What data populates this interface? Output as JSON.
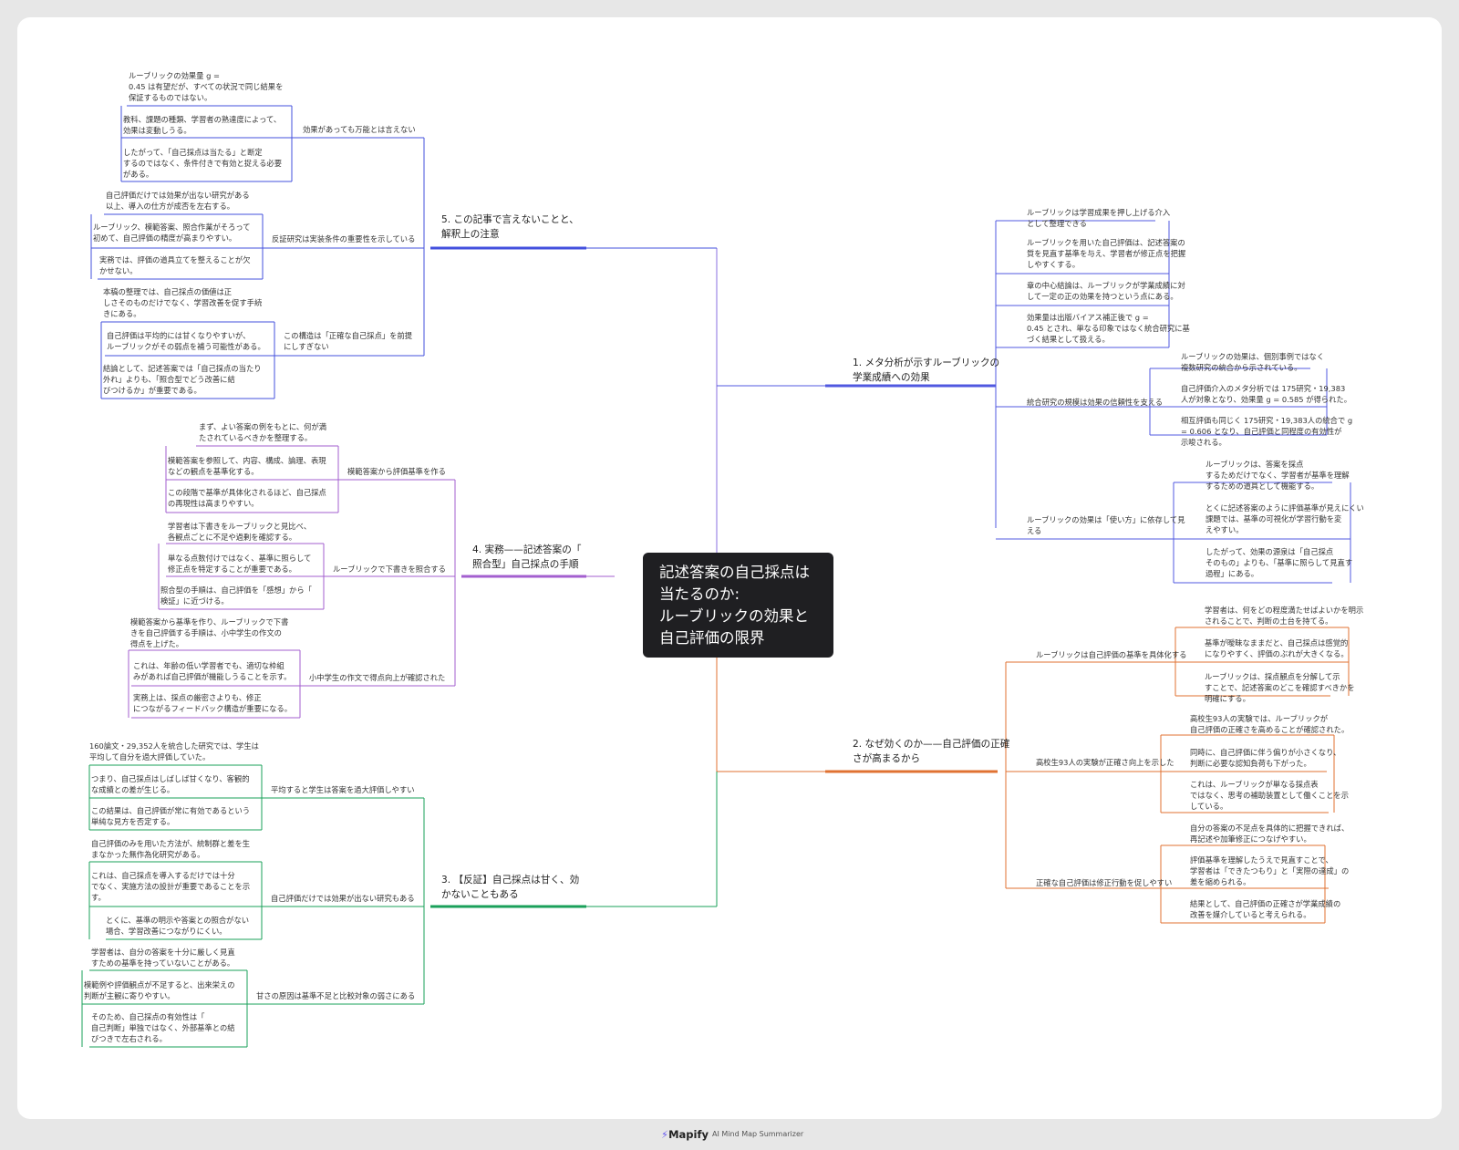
{
  "root": {
    "title": "記述答案の自己採点は\n当たるのか:\nルーブリックの効果と\n自己評価の限界"
  },
  "colors": {
    "b1": "#5058e0",
    "b2": "#e07232",
    "b3": "#1aa05a",
    "b4": "#a35fcf",
    "b5": "#4350de",
    "connector": "#8a6fe0"
  },
  "branches": [
    {
      "title": "1. メタ分析が示すルーブリックの\n学業成績への効果",
      "leaves": [
        "ルーブリックは学習成果を押し上げる介入\nとして整理できる",
        "ルーブリックを用いた自己評価は、記述答案の\n質を見直す基準を与え、学習者が修正点を把握\nしやすくする。",
        "章の中心結論は、ルーブリックが学業成績に対\nして一定の正の効果を持つという点にある。",
        "効果量は出版バイアス補正後で g =\n0.45 とされ、単なる印象ではなく統合研究に基\nづく結果として扱える。"
      ],
      "subs": [
        {
          "label": "統合研究の規模は効果の信頼性を支える",
          "leaves": [
            "ルーブリックの効果は、個別事例ではなく\n複数研究の統合から示されている。",
            "自己評価介入のメタ分析では 175研究・19,383\n人が対象となり、効果量 g = 0.585 が得られた。",
            "相互評価も同じく 175研究・19,383人の統合で g\n= 0.606 となり、自己評価と同程度の有効性が\n示唆される。"
          ]
        },
        {
          "label": "ルーブリックの効果は「使い方」に依存して見\nえる",
          "leaves": [
            "ルーブリックは、答案を採点\nするためだけでなく、学習者が基準を理解\nするための道具として機能する。",
            "とくに記述答案のように評価基準が見えにくい\n課題では、基準の可視化が学習行動を変\nえやすい。",
            "したがって、効果の源泉は「自己採点\nそのもの」よりも、「基準に照らして見直す\n過程」にある。"
          ]
        }
      ]
    },
    {
      "title": "2. なぜ効くのか——自己評価の正確\nさが高まるから",
      "subs": [
        {
          "label": "ルーブリックは自己評価の基準を具体化する",
          "leaves": [
            "学習者は、何をどの程度満たせばよいかを明示\nされることで、判断の土台を持てる。",
            "基準が曖昧なままだと、自己採点は感覚的\nになりやすく、評価のぶれが大きくなる。",
            "ルーブリックは、採点観点を分解して示\nすことで、記述答案のどこを確認すべきかを\n明確にする。"
          ]
        },
        {
          "label": "高校生93人の実験が正確さ向上を示した",
          "leaves": [
            "高校生93人の実験では、ルーブリックが\n自己評価の正確さを高めることが確認された。",
            "同時に、自己評価に伴う偏りが小さくなり、\n判断に必要な認知負荷も下がった。",
            "これは、ルーブリックが単なる採点表\nではなく、思考の補助装置として働くことを示\nしている。"
          ]
        },
        {
          "label": "正確な自己評価は修正行動を促しやすい",
          "leaves": [
            "自分の答案の不足点を具体的に把握できれば、\n再記述や加筆修正につなげやすい。",
            "評価基準を理解したうえで見直すことで、\n学習者は「できたつもり」と「実際の達成」の\n差を縮められる。",
            "結果として、自己評価の正確さが学業成績の\n改善を媒介していると考えられる。"
          ]
        }
      ]
    },
    {
      "title": "3. 【反証】自己採点は甘く、効\nかないこともある",
      "subs": [
        {
          "label": "平均すると学生は答案を過大評価しやすい",
          "leaves": [
            "160論文・29,352人を統合した研究では、学生は\n平均して自分を過大評価していた。",
            "つまり、自己採点はしばしば甘くなり、客観的\nな成績との差が生じる。",
            "この結果は、自己評価が常に有効であるという\n単純な見方を否定する。"
          ]
        },
        {
          "label": "自己評価だけでは効果が出ない研究もある",
          "leaves": [
            "自己評価のみを用いた方法が、統制群と差を生\nまなかった無作為化研究がある。",
            "これは、自己採点を導入するだけでは十分\nでなく、実施方法の設計が重要であることを示\nす。",
            "とくに、基準の明示や答案との照合がない\n場合、学習改善につながりにくい。"
          ]
        },
        {
          "label": "甘さの原因は基準不足と比較対象の弱さにある",
          "leaves": [
            "学習者は、自分の答案を十分に厳しく見直\nすための基準を持っていないことがある。",
            "模範例や評価観点が不足すると、出来栄えの\n判断が主観に寄りやすい。",
            "そのため、自己採点の有効性は「\n自己判断」単独ではなく、外部基準との結\nびつきで左右される。"
          ]
        }
      ]
    },
    {
      "title": "4. 実務——記述答案の「\n照合型」自己採点の手順",
      "subs": [
        {
          "label": "模範答案から評価基準を作る",
          "leaves": [
            "まず、よい答案の例をもとに、何が満\nたされているべきかを整理する。",
            "模範答案を参照して、内容、構成、論理、表現\nなどの観点を基準化する。",
            "この段階で基準が具体化されるほど、自己採点\nの再現性は高まりやすい。"
          ]
        },
        {
          "label": "ルーブリックで下書きを照合する",
          "leaves": [
            "学習者は下書きをルーブリックと見比べ、\n各観点ごとに不足や過剰を確認する。",
            "単なる点数付けではなく、基準に照らして\n修正点を特定することが重要である。",
            "照合型の手順は、自己評価を「感想」から「\n検証」に近づける。"
          ]
        },
        {
          "label": "小中学生の作文で得点向上が確認された",
          "leaves": [
            "模範答案から基準を作り、ルーブリックで下書\nきを自己評価する手順は、小中学生の作文の\n得点を上げた。",
            "これは、年齢の低い学習者でも、適切な枠組\nみがあれば自己評価が機能しうることを示す。",
            "実務上は、採点の厳密さよりも、修正\nにつながるフィードバック構造が重要になる。"
          ]
        }
      ]
    },
    {
      "title": "5. この記事で言えないことと、\n解釈上の注意",
      "subs": [
        {
          "label": "効果があっても万能とは言えない",
          "leaves": [
            "ルーブリックの効果量 g =\n0.45 は有望だが、すべての状況で同じ結果を\n保証するものではない。",
            "教科、課題の種類、学習者の熟達度によって、\n効果は変動しうる。",
            "したがって、「自己採点は当たる」と断定\nするのではなく、条件付きで有効と捉える必要\nがある。"
          ]
        },
        {
          "label": "反証研究は実装条件の重要性を示している",
          "leaves": [
            "自己評価だけでは効果が出ない研究がある\n以上、導入の仕方が成否を左右する。",
            "ルーブリック、模範答案、照合作業がそろって\n初めて、自己評価の精度が高まりやすい。",
            "実務では、評価の道具立てを整えることが欠\nかせない。"
          ]
        },
        {
          "label": "この構造は「正確な自己採点」を前提\nにしすぎない",
          "leaves": [
            "本稿の整理では、自己採点の価値は正\nしさそのものだけでなく、学習改善を促す手続\nきにある。",
            "自己評価は平均的には甘くなりやすいが、\nルーブリックがその弱点を補う可能性がある。",
            "結論として、記述答案では「自己採点の当たり\n外れ」よりも、「照合型でどう改善に結\nびつけるか」が重要である。"
          ]
        }
      ]
    }
  ],
  "footer": {
    "brand": "Mapify",
    "tagline": "AI Mind Map Summarizer"
  }
}
